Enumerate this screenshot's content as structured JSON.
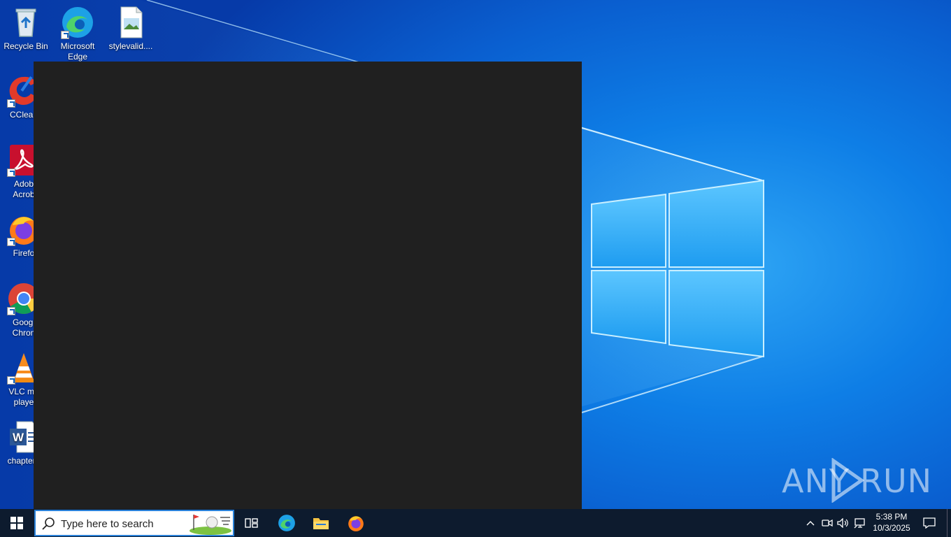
{
  "desktop": {
    "icons": [
      {
        "label": "Recycle Bin"
      },
      {
        "label": "Microsoft Edge"
      },
      {
        "label": "stylevalid...."
      },
      {
        "label": "CClean"
      },
      {
        "label": "Adob Acrob"
      },
      {
        "label": "Firefo"
      },
      {
        "label": "Googl Chron"
      },
      {
        "label": "VLC me playe"
      },
      {
        "label": "chaptera"
      }
    ]
  },
  "watermark": {
    "left": "ANY",
    "right": "RUN"
  },
  "taskbar": {
    "search": {
      "placeholder": "Type here to search"
    },
    "clock": {
      "time": "5:38 PM",
      "date": "10/3/2025"
    }
  },
  "colors": {
    "taskbar": "#0d1b2e",
    "window": "#202020",
    "accent": "#2a82da"
  }
}
